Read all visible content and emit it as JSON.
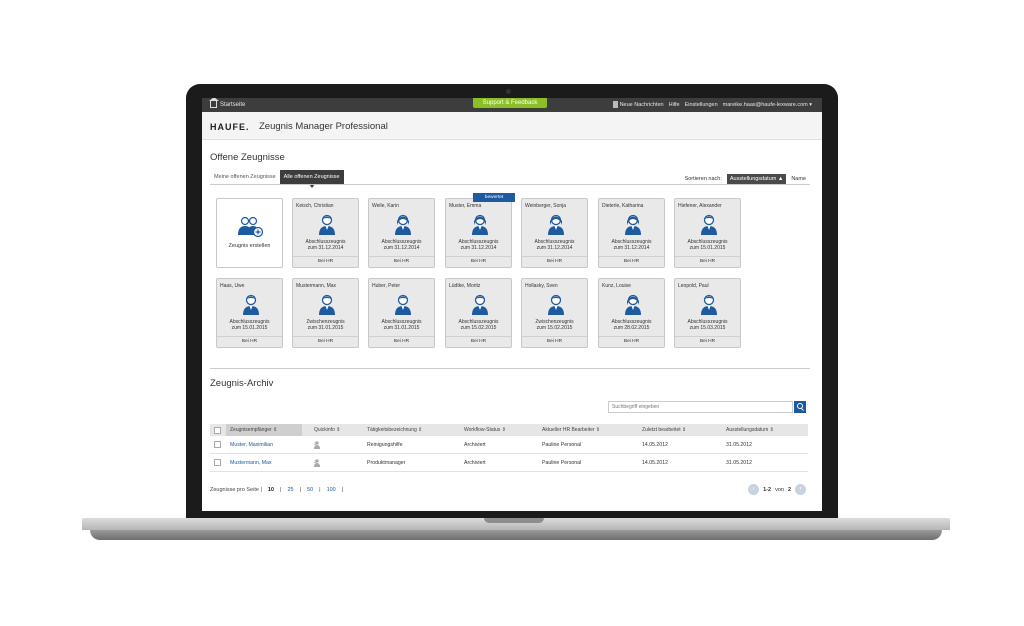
{
  "topbar": {
    "home_label": "Startseite",
    "support_label": "Support & Feedback",
    "messages": "Neue Nachrichten",
    "help": "Hilfe",
    "settings": "Einstellungen",
    "user": "mareike.haas@haufe-lexware.com ▾"
  },
  "brand": {
    "logo": "HAUFE.",
    "product": "Zeugnis Manager Professional"
  },
  "open": {
    "title": "Offene Zeugnisse",
    "tab_mine": "Meine offenen Zeugnisse",
    "tab_all": "Alle offenen Zeugnisse",
    "sort_label": "Sortieren nach:",
    "sort_active": "Ausstellungsdatum ▲",
    "sort_name": "Name",
    "create_label": "Zeugnis erstellen",
    "badge": "bewertet",
    "cards": [
      {
        "name": "Keisch, Christian",
        "type": "Abschlusszeugnis",
        "date": "zum 31.12.2014",
        "owner": "Bei HR",
        "gender": "m"
      },
      {
        "name": "Weile, Karin",
        "type": "Abschlusszeugnis",
        "date": "zum 31.12.2014",
        "owner": "Bei HR",
        "gender": "f"
      },
      {
        "name": "Muster, Emma",
        "type": "Abschlusszeugnis",
        "date": "zum 31.12.2014",
        "owner": "Bei HR",
        "gender": "f"
      },
      {
        "name": "Weinberger, Sonja",
        "type": "Abschlusszeugnis",
        "date": "zum 31.12.2014",
        "owner": "Bei HR",
        "gender": "f"
      },
      {
        "name": "Dieterle, Katharina",
        "type": "Abschlusszeugnis",
        "date": "zum 31.12.2014",
        "owner": "Bei HR",
        "gender": "f"
      },
      {
        "name": "Hiefener, Alexander",
        "type": "Abschlusszeugnis",
        "date": "zum 15.01.2015",
        "owner": "Bei HR",
        "gender": "m"
      },
      {
        "name": "Haas, Uwe",
        "type": "Abschlusszeugnis",
        "date": "zum 15.01.2015",
        "owner": "Bei HR",
        "gender": "m"
      },
      {
        "name": "Mustermann, Max",
        "type": "Zwischenzeugnis",
        "date": "zum 31.01.2015",
        "owner": "Bei HR",
        "gender": "m"
      },
      {
        "name": "Huber, Peter",
        "type": "Abschlusszeugnis",
        "date": "zum 31.01.2015",
        "owner": "Bei HR",
        "gender": "m"
      },
      {
        "name": "Lüdtke, Moritz",
        "type": "Abschlusszeugnis",
        "date": "zum 15.02.2015",
        "owner": "Bei HR",
        "gender": "m"
      },
      {
        "name": "Hollasky, Sven",
        "type": "Zwischenzeugnis",
        "date": "zum 15.02.2015",
        "owner": "Bei HR",
        "gender": "m"
      },
      {
        "name": "Kunz, Louise",
        "type": "Abschlusszeugnis",
        "date": "zum 28.02.2015",
        "owner": "Bei HR",
        "gender": "f"
      },
      {
        "name": "Leopold, Paul",
        "type": "Abschlusszeugnis",
        "date": "zum 15.03.2015",
        "owner": "Bei HR",
        "gender": "m"
      }
    ]
  },
  "archive": {
    "title": "Zeugnis-Archiv",
    "search_placeholder": "Suchbegriff eingeben",
    "columns": [
      "Zeugnisempfänger",
      "Quickinfo",
      "Tätigkeitsbezeichnung",
      "Workflow-Status",
      "Aktueller HR Bearbeiter",
      "Zuletzt bearbeitet",
      "Ausstellungsdatum"
    ],
    "rows": [
      {
        "recipient": "Muster, Maximilian",
        "quickinfo": "2",
        "job": "Reinigungshilfe",
        "status": "Archiviert",
        "editor": "Pauline Personal",
        "last": "14.05.2012",
        "issued": "31.05.2012"
      },
      {
        "recipient": "Mustermann, Max",
        "quickinfo": "2",
        "job": "Produktmanager",
        "status": "Archiviert",
        "editor": "Pauline Personal",
        "last": "14.05.2012",
        "issued": "31.05.2012"
      }
    ],
    "per_page_label": "Zeugnisse pro Seite |",
    "per_page": [
      "10",
      "25",
      "50",
      "100"
    ],
    "range": "1-2",
    "of": "von",
    "total": "2"
  },
  "colors": {
    "accent": "#1d5aa0",
    "support": "#8cbf26",
    "topbar": "#3d3d3d"
  }
}
